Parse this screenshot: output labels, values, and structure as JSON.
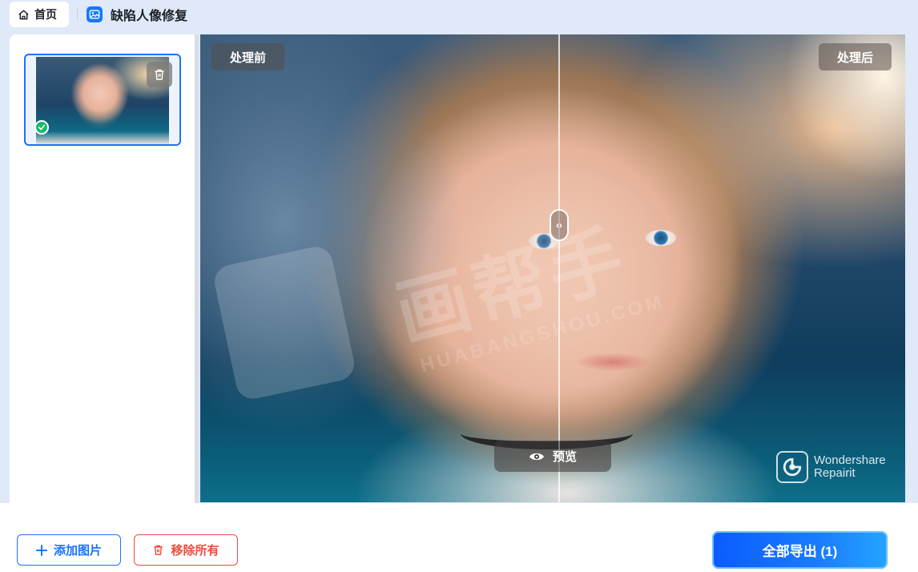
{
  "header": {
    "home_label": "首页",
    "page_title": "缺陷人像修复"
  },
  "preview": {
    "before_label": "处理前",
    "after_label": "处理后",
    "preview_button_label": "预览",
    "brand_line1": "Wondershare",
    "brand_line2": "Repairit",
    "watermark_text": "画帮手",
    "watermark_sub": "HUABANGSHOU.COM"
  },
  "thumbnails": {
    "count": 1,
    "selected_status": "check-icon"
  },
  "footer": {
    "add_label": "添加图片",
    "remove_label": "移除所有",
    "export_label": "全部导出 (1)"
  },
  "colors": {
    "accent": "#1a73ff",
    "danger": "#f04a3a",
    "success": "#18b96b",
    "topbar_bg": "#dfe9f8"
  }
}
